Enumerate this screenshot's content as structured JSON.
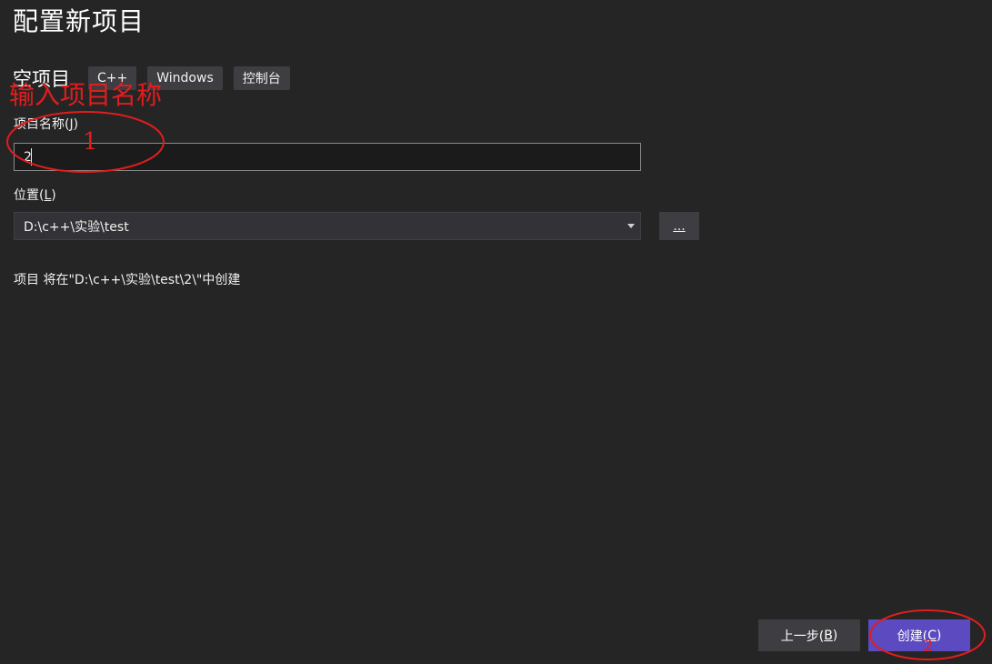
{
  "header": {
    "title": "配置新项目"
  },
  "template": {
    "name": "空项目",
    "tags": [
      "C++",
      "Windows",
      "控制台"
    ]
  },
  "project_name": {
    "label_prefix": "项目名称(",
    "label_key": "J",
    "label_suffix": ")",
    "value": "2"
  },
  "location": {
    "label_prefix": "位置(",
    "label_key": "L",
    "label_suffix": ")",
    "value": "D:\\c++\\实验\\test",
    "browse_label": "..."
  },
  "info": "项目 将在\"D:\\c++\\实验\\test\\2\\\"中创建",
  "buttons": {
    "back_prefix": "上一步(",
    "back_key": "B",
    "back_suffix": ")",
    "create_prefix": "创建(",
    "create_key": "C",
    "create_suffix": ")"
  },
  "annotations": {
    "hint": "输入项目名称",
    "step1": "1",
    "step2": "2",
    "color": "#e11d1d"
  },
  "colors": {
    "background": "#252526",
    "accent": "#5c4ac1"
  }
}
